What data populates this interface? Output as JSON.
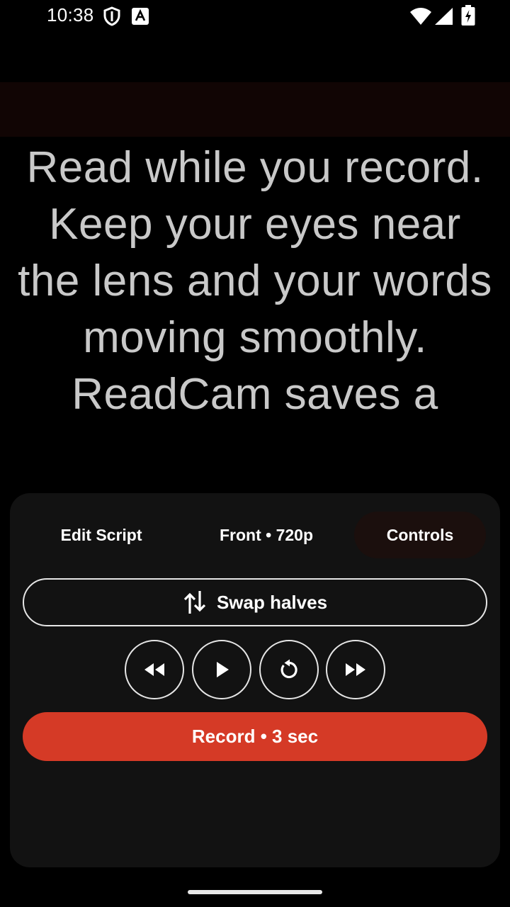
{
  "status_bar": {
    "time": "10:38",
    "icons": [
      "shield-icon",
      "a-icon",
      "wifi-icon",
      "cellular-icon",
      "battery-charging-icon"
    ]
  },
  "prompter": {
    "text": "Read while you record. Keep your eyes near the lens and your words moving smoothly. ReadCam saves a"
  },
  "tabs": {
    "edit_script": "Edit Script",
    "camera": "Front • 720p",
    "controls": "Controls"
  },
  "controls": {
    "swap_label": "Swap halves",
    "buttons": [
      "rewind-icon",
      "play-icon",
      "restart-icon",
      "fast-forward-icon"
    ]
  },
  "record": {
    "label": "Record • 3 sec"
  },
  "colors": {
    "accent": "#d53a26",
    "camera_strip": "#110504",
    "panel": "#121212",
    "active_tab": "#1b0f0d"
  }
}
